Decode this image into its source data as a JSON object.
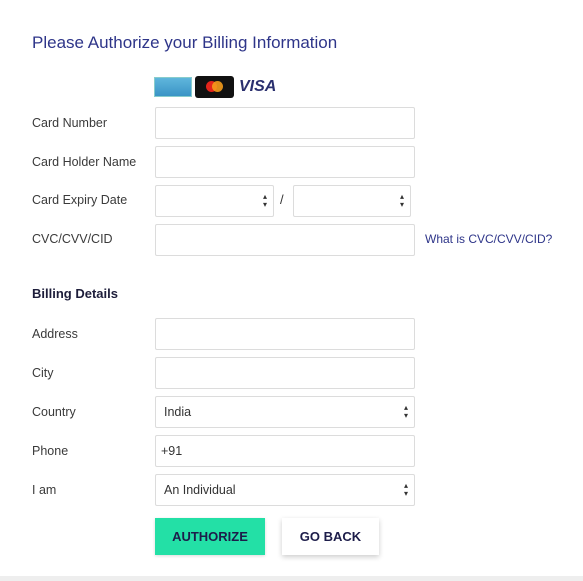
{
  "title": "Please Authorize your Billing Information",
  "card_logos": [
    "amex",
    "mastercard",
    "VISA"
  ],
  "card": {
    "number_label": "Card Number",
    "number_value": "",
    "holder_label": "Card Holder Name",
    "holder_value": "",
    "expiry_label": "Card Expiry Date",
    "expiry_month": "",
    "expiry_year": "",
    "expiry_separator": "/",
    "cvc_label": "CVC/CVV/CID",
    "cvc_value": "",
    "cvc_help": "What is CVC/CVV/CID?"
  },
  "billing": {
    "heading": "Billing Details",
    "address_label": "Address",
    "address_value": "",
    "city_label": "City",
    "city_value": "",
    "country_label": "Country",
    "country_value": "India",
    "phone_label": "Phone",
    "phone_value": "+91",
    "iam_label": "I am",
    "iam_value": "An Individual"
  },
  "buttons": {
    "authorize": "AUTHORIZE",
    "go_back": "GO BACK"
  },
  "colors": {
    "accent": "#2e3589",
    "authorize": "#23e0a6"
  }
}
